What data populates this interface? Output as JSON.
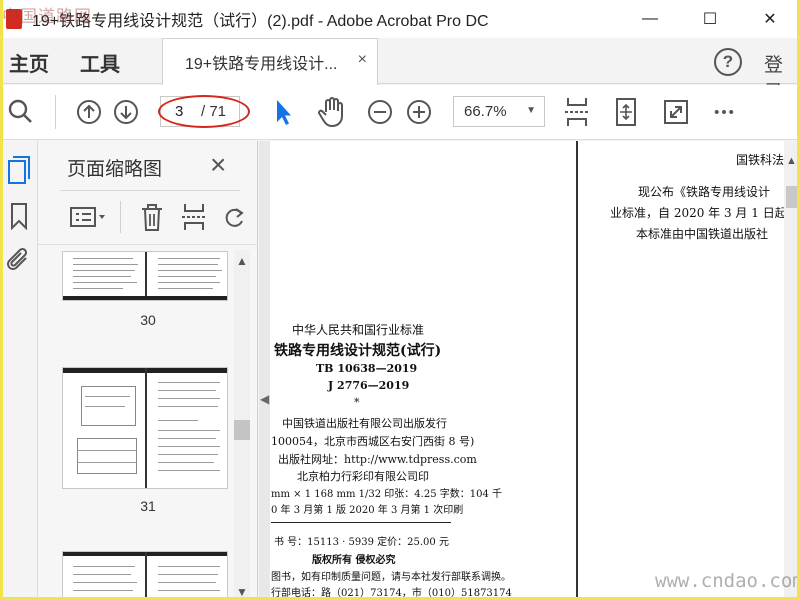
{
  "window": {
    "title": "19+铁路专用线设计规范（试行）(2).pdf - Adobe Acrobat Pro DC",
    "watermark": "中国道路网",
    "minimize": "—",
    "maximize": "☐",
    "close": "✕"
  },
  "menu": {
    "home": "主页",
    "tools": "工具",
    "help_glyph": "?",
    "login": "登录"
  },
  "tab": {
    "label": "19+铁路专用线设计...",
    "close": "×"
  },
  "toolbar": {
    "current_page": "3",
    "total_pages": "/ 71",
    "zoom": "66.7%",
    "more": "•••"
  },
  "panel": {
    "title": "页面缩略图",
    "close": "×"
  },
  "thumbnails": [
    {
      "number": "30"
    },
    {
      "number": "31"
    }
  ],
  "left_page": {
    "lines": [
      "中华人民共和国行业标准",
      "铁路专用线设计规范(试行)",
      "TB 10638—2019",
      "J 2776—2019",
      "*",
      "中国铁道出版社有限公司出版发行",
      "100054，北京市西城区右安门西街 8 号)",
      "出版社网址：http://www.tdpress.com",
      "北京柏力行彩印有限公司印",
      "mm × 1 168 mm   1/32   印张：4.25   字数：104 千",
      "0 年 3 月第 1 版   2020 年 3 月第 1 次印刷",
      "书   号：15113 · 5939   定价：25.00 元",
      "版权所有   侵权必究",
      "图书，如有印制质量问题，请与本社发行部联系调换。",
      "行部电话：路（021）73174，市（010）51873174"
    ]
  },
  "right_page": {
    "lines": [
      "国铁科法",
      "现公布《铁路专用线设计",
      "业标准，自 2020 年 3 月 1 日起",
      "本标准由中国铁道出版社"
    ]
  },
  "footer_watermark": "www.cndao.com",
  "colors": {
    "accent_blue": "#1473e6",
    "annotation_red": "#d9261c",
    "frame_yellow": "#f2e34b"
  }
}
